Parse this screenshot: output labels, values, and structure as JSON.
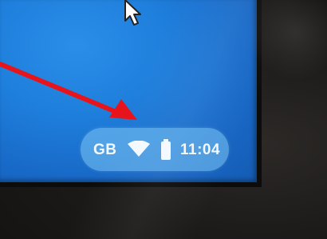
{
  "screen": {
    "status_bar": {
      "country_code": "GB",
      "wifi_icon": "wifi-icon",
      "battery_icon": "battery-icon",
      "time": "11:04"
    },
    "cursor_icon": "mouse-pointer-icon"
  },
  "annotation": {
    "arrow_icon": "red-arrow-icon",
    "arrow_color": "#e8141b"
  },
  "colors": {
    "screen_blue": "#1f7fdc",
    "pill_tint": "#7dc8f5",
    "bezel": "#1d1b1a"
  }
}
